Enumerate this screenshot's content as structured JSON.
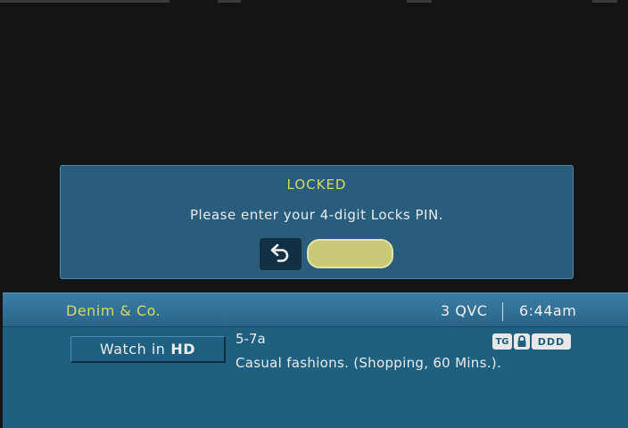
{
  "dialog": {
    "title": "LOCKED",
    "message": "Please enter your 4-digit Locks PIN.",
    "back_icon": "return-arrow-icon",
    "pin_value": ""
  },
  "info_bar": {
    "show_title": "Denim & Co.",
    "channel": "3 QVC",
    "time": "6:44am",
    "watch_button_prefix": "Watch in",
    "watch_button_hd": "HD",
    "time_range": "5-7a",
    "description": "Casual fashions. (Shopping, 60 Mins.).",
    "badges": {
      "tv_rating": "TG",
      "lock": "lock-icon",
      "dolby": "DDD"
    }
  },
  "colors": {
    "dialog_bg": "#2a5d7c",
    "accent_yellow": "#d8d86a",
    "pin_field": "#c9c978",
    "info_body": "#1f5f7f"
  }
}
